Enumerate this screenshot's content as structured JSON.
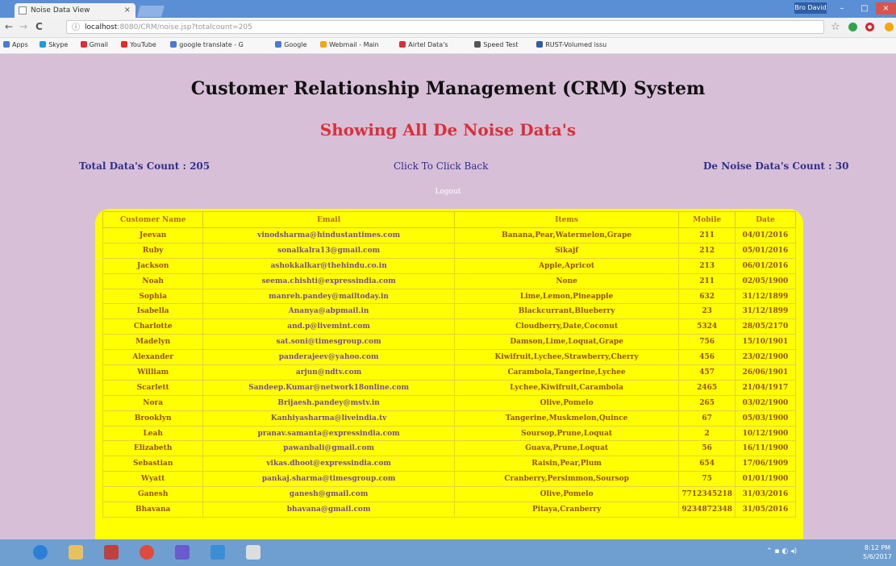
{
  "browser": {
    "tab_title": "Noise Data View",
    "tab_close": "×",
    "url_host": "localhost",
    "url_path": ":8080/CRM/noise.jsp?totalcount=205",
    "user_label": "Bro David",
    "bookmarks": [
      {
        "label": "Apps",
        "color": "#4a7bd0"
      },
      {
        "label": "Skype",
        "color": "#1e9bd7"
      },
      {
        "label": "Gmail",
        "color": "#d9303a"
      },
      {
        "label": "YouTube",
        "color": "#e52d27"
      },
      {
        "label": "google translate - G",
        "color": "#4a7bd0"
      },
      {
        "label": "Google",
        "color": "#4a7bd0"
      },
      {
        "label": "Webmail - Main",
        "color": "#f2a70a"
      },
      {
        "label": "Airtel Data's",
        "color": "#d9303a"
      },
      {
        "label": "Speed Test",
        "color": "#555555"
      },
      {
        "label": "RUST-Volumed issu",
        "color": "#2d5fa8"
      }
    ]
  },
  "page": {
    "title": "Customer Relationship Management (CRM) System",
    "subtitle": "Showing All De Noise Data's",
    "total_count_label": "Total Data's Count :",
    "total_count_value": "205",
    "back_link": "Click To Click Back",
    "denoise_count_label": "De Noise Data's Count :",
    "denoise_count_value": "30",
    "logout": "Logout"
  },
  "table": {
    "headers": [
      "Customer Name",
      "Email",
      "Items",
      "Mobile",
      "Date"
    ],
    "rows": [
      [
        "Jeevan",
        "vinodsharma@hindustantimes.com",
        "Banana,Pear,Watermelon,Grape",
        "211",
        "04/01/2016"
      ],
      [
        "Ruby",
        "sonalkalra13@gmail.com",
        "Sikajf",
        "212",
        "05/01/2016"
      ],
      [
        "Jackson",
        "ashokkalkar@thehindu.co.in",
        "Apple,Apricot",
        "213",
        "06/01/2016"
      ],
      [
        "Noah",
        "seema.chishti@expressindia.com",
        "None",
        "211",
        "02/05/1900"
      ],
      [
        "Sophia",
        "manreh.pandey@mailtoday.in",
        "Lime,Lemon,Pineapple",
        "632",
        "31/12/1899"
      ],
      [
        "Isabella",
        "Ananya@abpmail.in",
        "Blackcurrant,Blueberry",
        "23",
        "31/12/1899"
      ],
      [
        "Charlotte",
        "and.p@livemint.com",
        "Cloudberry,Date,Coconut",
        "5324",
        "28/05/2170"
      ],
      [
        "Madelyn",
        "sat.soni@timesgroup.com",
        "Damson,Lime,Loquat,Grape",
        "756",
        "15/10/1901"
      ],
      [
        "Alexander",
        "panderajeev@yahoo.com",
        "Kiwifruit,Lychee,Strawberry,Cherry",
        "456",
        "23/02/1900"
      ],
      [
        "William",
        "arjun@ndtv.com",
        "Carambola,Tangerine,Lychee",
        "457",
        "26/06/1901"
      ],
      [
        "Scarlett",
        "Sandeep.Kumar@network18online.com",
        "Lychee,Kiwifruit,Carambola",
        "2465",
        "21/04/1917"
      ],
      [
        "Nora",
        "Brijaesh.pandey@mstv.in",
        "Olive,Pomelo",
        "265",
        "03/02/1900"
      ],
      [
        "Brooklyn",
        "Kanhiyasharma@liveindia.tv",
        "Tangerine,Muskmelon,Quince",
        "67",
        "05/03/1900"
      ],
      [
        "Leah",
        "pranav.samanta@expressindia.com",
        "Soursop,Prune,Loquat",
        "2",
        "10/12/1900"
      ],
      [
        "Elizabeth",
        "pawanbali@gmail.com",
        "Guava,Prune,Loquat",
        "56",
        "16/11/1900"
      ],
      [
        "Sebastian",
        "vikas.dhoot@expressindia.com",
        "Raisin,Pear,Plum",
        "654",
        "17/06/1909"
      ],
      [
        "Wyatt",
        "pankaj.sharma@timesgroup.com",
        "Cranberry,Persimmon,Soursop",
        "75",
        "01/01/1900"
      ],
      [
        "Ganesh",
        "ganesh@gmail.com",
        "Olive,Pomelo",
        "7712345218",
        "31/03/2016"
      ],
      [
        "Bhavana",
        "bhavana@gmail.com",
        "Pitaya,Cranberry",
        "9234872348",
        "31/05/2016"
      ]
    ]
  },
  "taskbar": {
    "time": "8:12 PM",
    "date": "5/6/2017",
    "apps": [
      {
        "name": "internet-explorer-icon",
        "color": "#2b7fd4"
      },
      {
        "name": "file-explorer-icon",
        "color": "#e8c060"
      },
      {
        "name": "app-icon",
        "color": "#c04040"
      },
      {
        "name": "chrome-icon",
        "color": "#e04a3a"
      },
      {
        "name": "app-icon-2",
        "color": "#6a5acd"
      },
      {
        "name": "app-icon-3",
        "color": "#3a8fd4"
      },
      {
        "name": "app-icon-4",
        "color": "#dddddd"
      }
    ]
  }
}
